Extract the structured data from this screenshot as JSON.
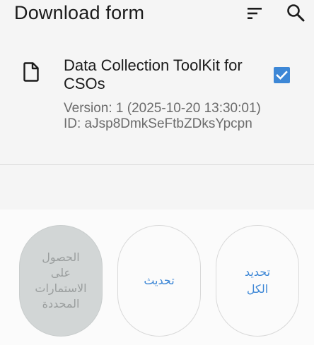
{
  "app_bar": {
    "title": "Download form",
    "sort_icon": "sort-icon",
    "search_icon": "search-icon"
  },
  "form_list": {
    "items": [
      {
        "icon": "file-icon",
        "title": "Data Collection ToolKit for CSOs",
        "meta": "Version: 1 (2025-10-20 13:30:01) ID: aJsp8DmkSeFtbZDksYpcpn",
        "checked": true
      }
    ]
  },
  "actions": {
    "get_selected_label": "الحصول على الاستمارات المحددة",
    "refresh_label": "تحديث",
    "select_all_label": "تحديد الكل"
  },
  "colors": {
    "accent": "#3d87d6",
    "disabled_bg": "#d2d6d6",
    "disabled_text": "#9a9e9e",
    "background": "#f5f5f5"
  }
}
